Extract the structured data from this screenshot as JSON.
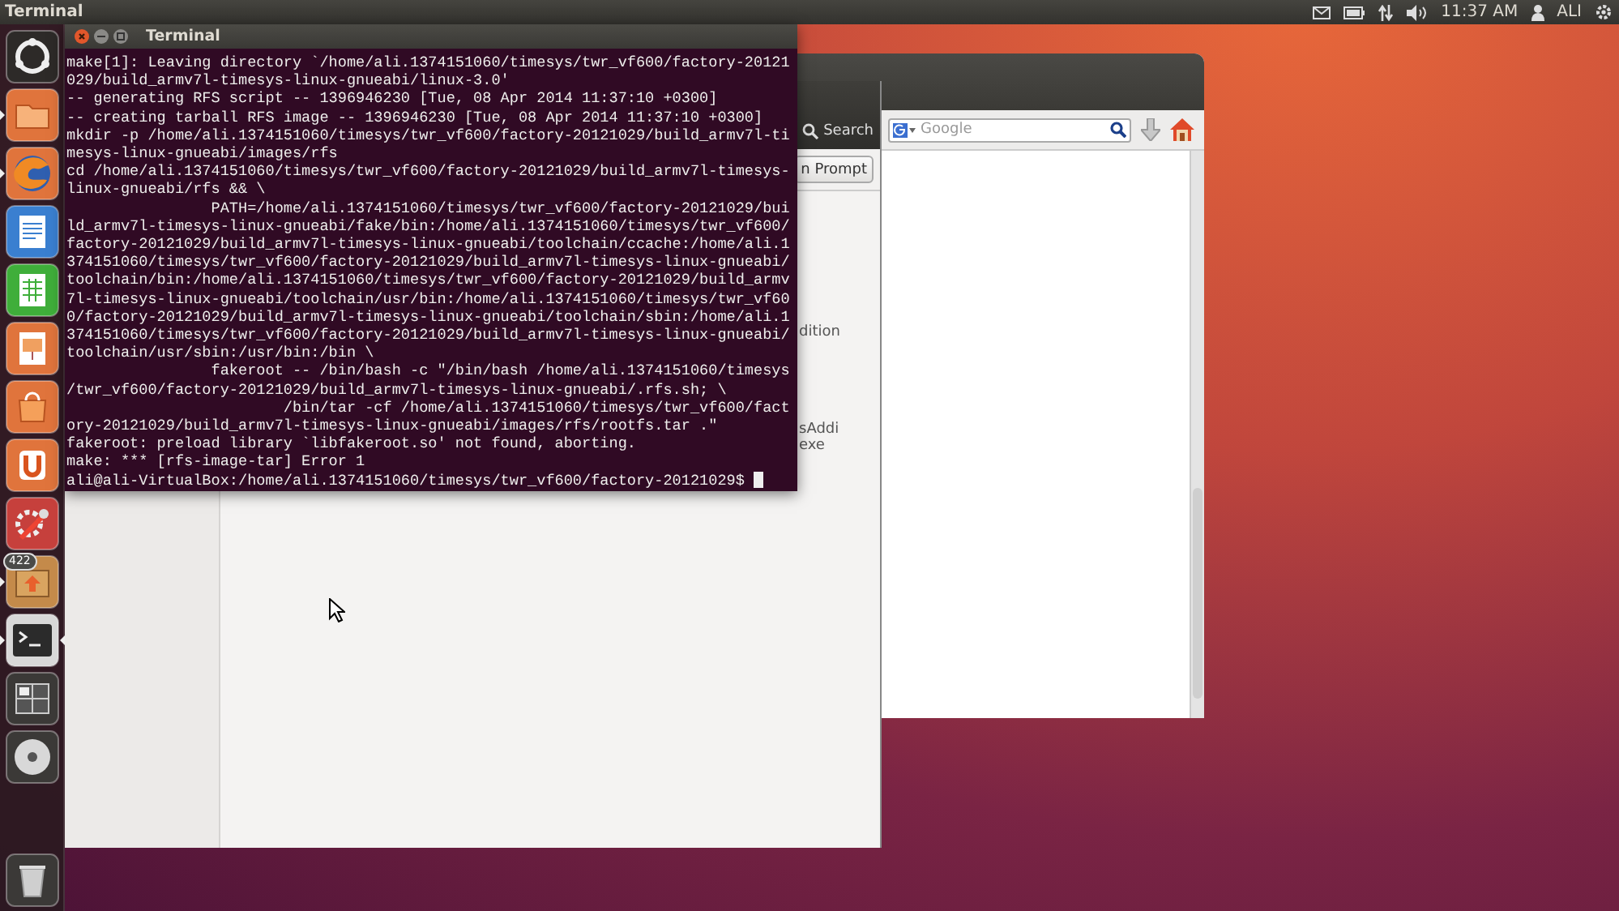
{
  "top_panel": {
    "app_title": "Terminal",
    "clock": "11:37 AM",
    "user": "ALI"
  },
  "launcher": {
    "items": [
      {
        "kind": "dash",
        "running": false,
        "focused": false
      },
      {
        "kind": "files",
        "running": true,
        "focused": false
      },
      {
        "kind": "browser",
        "running": true,
        "focused": false
      },
      {
        "kind": "writer",
        "running": false,
        "focused": false
      },
      {
        "kind": "calc",
        "running": false,
        "focused": false
      },
      {
        "kind": "impress",
        "running": false,
        "focused": false
      },
      {
        "kind": "store",
        "running": false,
        "focused": false
      },
      {
        "kind": "cloud",
        "running": false,
        "focused": false
      },
      {
        "kind": "settings",
        "running": false,
        "focused": false
      },
      {
        "kind": "updates",
        "running": true,
        "focused": false,
        "badge": "422"
      },
      {
        "kind": "terminal",
        "running": true,
        "focused": true
      },
      {
        "kind": "workspaces",
        "running": false,
        "focused": false
      },
      {
        "kind": "disc",
        "running": false,
        "focused": false
      },
      {
        "kind": "trash",
        "running": false,
        "focused": false
      }
    ]
  },
  "browser_window": {
    "search": {
      "placeholder": "Google"
    }
  },
  "back_window": {
    "search_label": "Search",
    "button": "n Prompt",
    "texts": [
      "dition",
      "sAddi",
      "exe"
    ]
  },
  "terminal": {
    "title": "Terminal",
    "cursor_visible": true,
    "lines": [
      "make[1]: Leaving directory `/home/ali.1374151060/timesys/twr_vf600/factory-20121",
      "029/build_armv7l-timesys-linux-gnueabi/linux-3.0'",
      "-- generating RFS script -- 1396946230 [Tue, 08 Apr 2014 11:37:10 +0300]",
      "-- creating tarball RFS image -- 1396946230 [Tue, 08 Apr 2014 11:37:10 +0300]",
      "mkdir -p /home/ali.1374151060/timesys/twr_vf600/factory-20121029/build_armv7l-ti",
      "mesys-linux-gnueabi/images/rfs",
      "cd /home/ali.1374151060/timesys/twr_vf600/factory-20121029/build_armv7l-timesys-",
      "linux-gnueabi/rfs && \\",
      "                PATH=/home/ali.1374151060/timesys/twr_vf600/factory-20121029/bui",
      "ld_armv7l-timesys-linux-gnueabi/fake/bin:/home/ali.1374151060/timesys/twr_vf600/",
      "factory-20121029/build_armv7l-timesys-linux-gnueabi/toolchain/ccache:/home/ali.1",
      "374151060/timesys/twr_vf600/factory-20121029/build_armv7l-timesys-linux-gnueabi/",
      "toolchain/bin:/home/ali.1374151060/timesys/twr_vf600/factory-20121029/build_armv",
      "7l-timesys-linux-gnueabi/toolchain/usr/bin:/home/ali.1374151060/timesys/twr_vf60",
      "0/factory-20121029/build_armv7l-timesys-linux-gnueabi/toolchain/sbin:/home/ali.1",
      "374151060/timesys/twr_vf600/factory-20121029/build_armv7l-timesys-linux-gnueabi/",
      "toolchain/usr/sbin:/usr/bin:/bin \\",
      "                fakeroot -- /bin/bash -c \"/bin/bash /home/ali.1374151060/timesys",
      "/twr_vf600/factory-20121029/build_armv7l-timesys-linux-gnueabi/.rfs.sh; \\",
      "                        /bin/tar -cf /home/ali.1374151060/timesys/twr_vf600/fact",
      "ory-20121029/build_armv7l-timesys-linux-gnueabi/images/rfs/rootfs.tar .\"",
      "fakeroot: preload library `libfakeroot.so' not found, aborting.",
      "make: *** [rfs-image-tar] Error 1",
      "ali@ali-VirtualBox:/home/ali.1374151060/timesys/twr_vf600/factory-20121029$ "
    ]
  }
}
